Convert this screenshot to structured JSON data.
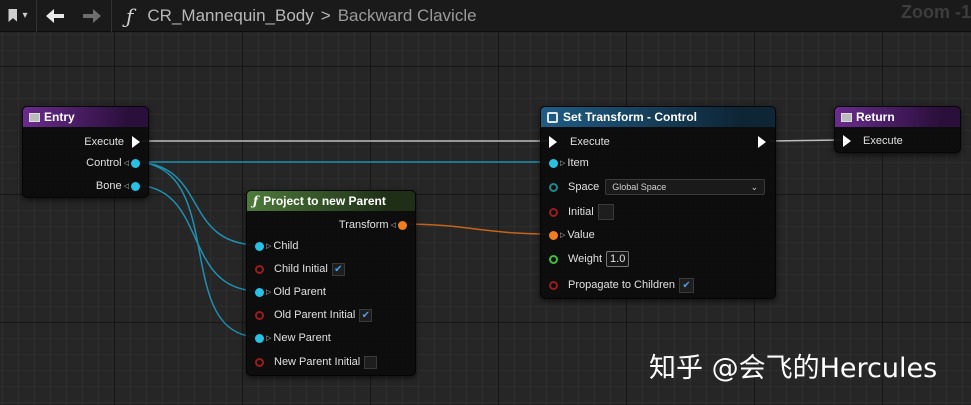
{
  "toolbar": {
    "function_symbol": "ƒ",
    "breadcrumb_parent": "CR_Mannequin_Body",
    "breadcrumb_separator": ">",
    "breadcrumb_current": "Backward Clavicle",
    "zoom_label": "Zoom -1"
  },
  "colors": {
    "background": "#262626",
    "exec_wire": "#bdbdbd",
    "item_wire": "#27c1e6",
    "transform_wire": "#f07d1e",
    "check_accent": "#4a9de8"
  },
  "nodes": {
    "entry": {
      "title": "Entry",
      "pins": {
        "execute": "Execute",
        "control": "Control",
        "bone": "Bone"
      }
    },
    "project": {
      "title": "Project to new Parent",
      "function_symbol": "ƒ",
      "pins": {
        "transform": "Transform",
        "child": "Child",
        "child_initial": "Child Initial",
        "old_parent": "Old Parent",
        "old_parent_initial": "Old Parent Initial",
        "new_parent": "New Parent",
        "new_parent_initial": "New Parent Initial"
      },
      "checks": {
        "child_initial": "✔",
        "old_parent_initial": "✔",
        "new_parent_initial": ""
      }
    },
    "set_transform": {
      "title": "Set Transform - Control",
      "pins": {
        "execute": "Execute",
        "item": "Item",
        "space": "Space",
        "space_value": "Global Space",
        "initial": "Initial",
        "value": "Value",
        "weight": "Weight",
        "weight_value": "1.0",
        "propagate": "Propagate to Children"
      },
      "checks": {
        "initial": "",
        "propagate": "✔"
      }
    },
    "return": {
      "title": "Return",
      "pins": {
        "execute": "Execute"
      }
    }
  },
  "watermark": "知乎 @会飞的Hercules"
}
